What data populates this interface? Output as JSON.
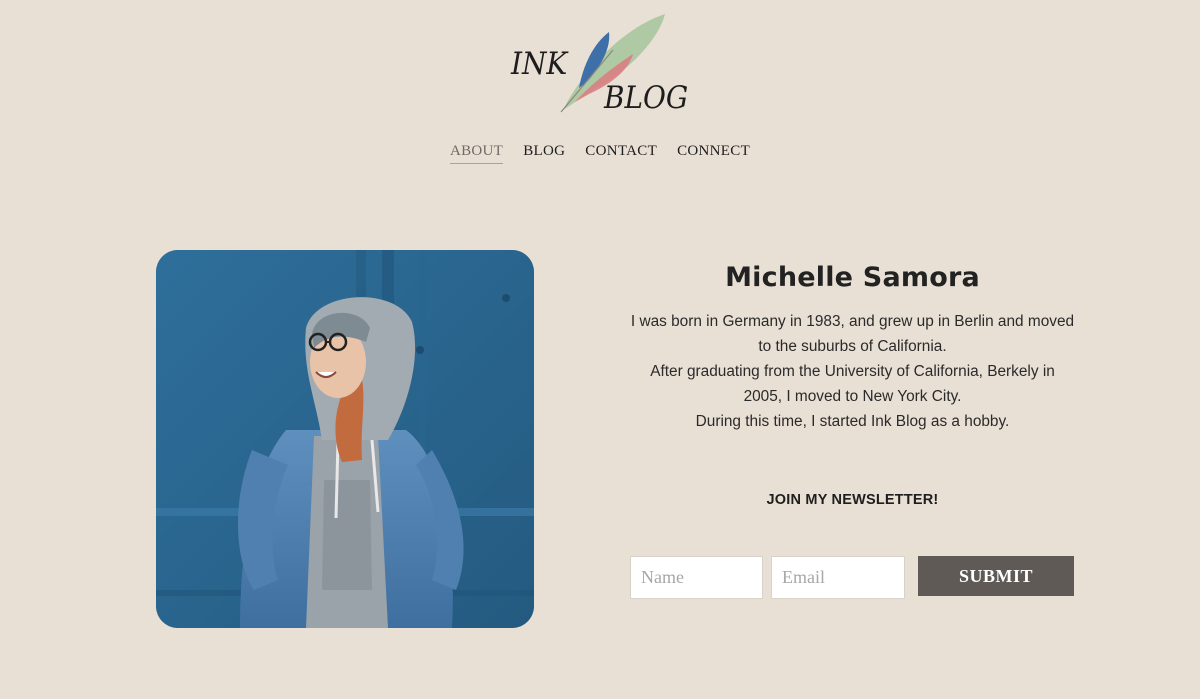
{
  "brand": {
    "logo_line1": "INK",
    "logo_line2": "BLOG",
    "feather_colors": [
      "#3f6fa8",
      "#d97f82",
      "#a9c7a0"
    ]
  },
  "nav": {
    "items": [
      {
        "label": "ABOUT",
        "active": true
      },
      {
        "label": "BLOG",
        "active": false
      },
      {
        "label": "CONTACT",
        "active": false
      },
      {
        "label": "CONNECT",
        "active": false
      }
    ]
  },
  "profile": {
    "name": "Michelle Samora",
    "bio_lines": [
      "I was born in Germany in 1983, and grew up in Berlin and moved",
      "to the suburbs of California.",
      "After graduating from the University of California, Berkely in",
      "2005, I moved to New York City.",
      "During this time, I started Ink Blog as a hobby."
    ]
  },
  "newsletter": {
    "title": "JOIN MY NEWSLETTER!",
    "name_placeholder": "Name",
    "email_placeholder": "Email",
    "submit_label": "SUBMIT"
  },
  "colors": {
    "background": "#e9e0d5",
    "submit_bg": "#5f5a56",
    "active_nav": "#6f6a66"
  }
}
